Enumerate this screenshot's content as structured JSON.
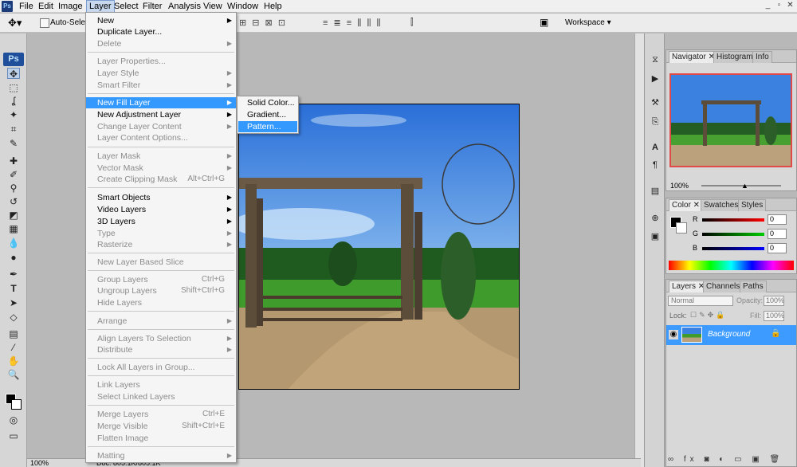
{
  "menubar": {
    "logo": "Ps",
    "items": [
      "File",
      "Edit",
      "Image",
      "Layer",
      "Select",
      "Filter",
      "Analysis",
      "View",
      "Window",
      "Help"
    ],
    "window_controls": [
      "_",
      "▫",
      "✕"
    ]
  },
  "optionsbar": {
    "auto_select_label": "Auto-Select:",
    "workspace_label": "Workspace ▾"
  },
  "toolbox": {
    "badge": "Ps",
    "icons": [
      "move-icon",
      "marquee-icon",
      "lasso-icon",
      "magic-wand-icon",
      "crop-icon",
      "eyedropper-icon",
      "healing-brush-icon",
      "brush-icon",
      "clone-stamp-icon",
      "history-brush-icon",
      "eraser-icon",
      "gradient-icon",
      "blur-icon",
      "dodge-icon",
      "pen-icon",
      "type-icon",
      "path-select-icon",
      "shape-icon",
      "notes-icon",
      "eyedropper2-icon",
      "hand-icon",
      "zoom-icon",
      "colors-icon",
      "quickmask-icon",
      "screen-mode-icon"
    ]
  },
  "layer_menu": {
    "items": [
      {
        "label": "New",
        "sub": true,
        "disabled": false
      },
      {
        "label": "Duplicate Layer...",
        "disabled": false
      },
      {
        "label": "Delete",
        "sub": true,
        "disabled": true
      },
      {
        "label": "Layer Properties...",
        "disabled": true
      },
      {
        "label": "Layer Style",
        "sub": true,
        "disabled": true
      },
      {
        "label": "Smart Filter",
        "sub": true,
        "disabled": true
      },
      {
        "label": "New Fill Layer",
        "sub": true,
        "disabled": false,
        "selected": true
      },
      {
        "label": "New Adjustment Layer",
        "sub": true,
        "disabled": false
      },
      {
        "label": "Change Layer Content",
        "sub": true,
        "disabled": true
      },
      {
        "label": "Layer Content Options...",
        "disabled": true
      },
      {
        "label": "Layer Mask",
        "sub": true,
        "disabled": true
      },
      {
        "label": "Vector Mask",
        "sub": true,
        "disabled": true
      },
      {
        "label": "Create Clipping Mask",
        "shortcut": "Alt+Ctrl+G",
        "disabled": true
      },
      {
        "label": "Smart Objects",
        "sub": true,
        "disabled": false
      },
      {
        "label": "Video Layers",
        "sub": true,
        "disabled": false
      },
      {
        "label": "3D Layers",
        "sub": true,
        "disabled": false
      },
      {
        "label": "Type",
        "sub": true,
        "disabled": true
      },
      {
        "label": "Rasterize",
        "sub": true,
        "disabled": true
      },
      {
        "label": "New Layer Based Slice",
        "disabled": true
      },
      {
        "label": "Group Layers",
        "shortcut": "Ctrl+G",
        "disabled": true
      },
      {
        "label": "Ungroup Layers",
        "shortcut": "Shift+Ctrl+G",
        "disabled": true
      },
      {
        "label": "Hide Layers",
        "disabled": true
      },
      {
        "label": "Arrange",
        "sub": true,
        "disabled": true
      },
      {
        "label": "Align Layers To Selection",
        "sub": true,
        "disabled": true
      },
      {
        "label": "Distribute",
        "sub": true,
        "disabled": true
      },
      {
        "label": "Lock All Layers in Group...",
        "disabled": true
      },
      {
        "label": "Link Layers",
        "disabled": true
      },
      {
        "label": "Select Linked Layers",
        "disabled": true
      },
      {
        "label": "Merge Layers",
        "shortcut": "Ctrl+E",
        "disabled": true
      },
      {
        "label": "Merge Visible",
        "shortcut": "Shift+Ctrl+E",
        "disabled": true
      },
      {
        "label": "Flatten Image",
        "disabled": true
      },
      {
        "label": "Matting",
        "sub": true,
        "disabled": true
      }
    ]
  },
  "fill_submenu": {
    "items": [
      "Solid Color...",
      "Gradient...",
      "Pattern..."
    ],
    "selected_index": 2
  },
  "navigator": {
    "tabs": [
      "Navigator ✕",
      "Histogram",
      "Info"
    ],
    "zoom": "100%"
  },
  "color_panel": {
    "tabs": [
      "Color ✕",
      "Swatches",
      "Styles"
    ],
    "r_label": "R",
    "g_label": "G",
    "b_label": "B",
    "r_value": "0",
    "g_value": "0",
    "b_value": "0"
  },
  "layers_panel": {
    "tabs": [
      "Layers ✕",
      "Channels",
      "Paths"
    ],
    "blend_mode": "Normal",
    "opacity_label": "Opacity:",
    "opacity_value": "100%",
    "lock_label": "Lock:",
    "fill_label": "Fill:",
    "fill_value": "100%",
    "layer_name": "Background"
  },
  "status": {
    "zoom": "100%",
    "doc": "Doc: 805.1K/805.1K"
  },
  "colors": {
    "selection_blue": "#3399ff",
    "layer_row_blue": "#3d9bff"
  }
}
